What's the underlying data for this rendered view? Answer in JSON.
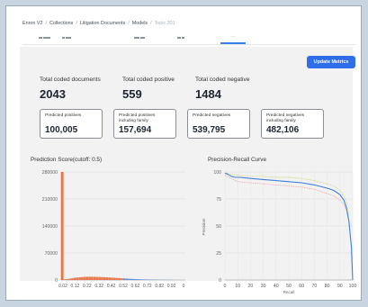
{
  "breadcrumb": [
    "Enron V2",
    "Collections",
    "Litigation Documents",
    "Models",
    "Topic 301"
  ],
  "tabs": [
    "",
    "",
    "",
    "",
    "..."
  ],
  "update_button": "Update Metrics",
  "stats": [
    {
      "label": "Total coded documents",
      "value": "2043"
    },
    {
      "label": "Total coded positive",
      "value": "559"
    },
    {
      "label": "Total coded negative",
      "value": "1484"
    }
  ],
  "cards": [
    {
      "label": "Predicted positives",
      "value": "100,005"
    },
    {
      "label": "Predicted positives including family",
      "value": "157,694"
    },
    {
      "label": "Predicted negatives",
      "value": "539,795"
    },
    {
      "label": "Predicted negatives including family",
      "value": "482,106"
    }
  ],
  "chart_data": [
    {
      "type": "bar",
      "title": "Prediction Score(cutoff: 0.5)",
      "xlabel": "",
      "ylabel": "",
      "y_ticks": [
        "0",
        "70000",
        "140000",
        "210000",
        "280000"
      ],
      "x_ticks": [
        "0.02",
        "0.12",
        "0.22",
        "0.32",
        "0.42",
        "0.52",
        "0.62",
        "0.72",
        "0.82",
        "0.92",
        "0"
      ],
      "ylim": [
        0,
        280000
      ],
      "colors": {
        "below_cutoff": "#e8622c",
        "above_cutoff": "#3f7fd9"
      },
      "bins_x": [
        0.01,
        0.03,
        0.05,
        0.07,
        0.09,
        0.11,
        0.13,
        0.15,
        0.17,
        0.19,
        0.21,
        0.23,
        0.25,
        0.27,
        0.29,
        0.31,
        0.33,
        0.35,
        0.37,
        0.39,
        0.41,
        0.43,
        0.45,
        0.47,
        0.49,
        0.51,
        0.53,
        0.55,
        0.57,
        0.59,
        0.61,
        0.63,
        0.65,
        0.67,
        0.69,
        0.71,
        0.73,
        0.75,
        0.77,
        0.79,
        0.81,
        0.83,
        0.85,
        0.87,
        0.89,
        0.91,
        0.93,
        0.95,
        0.97,
        0.99
      ],
      "values": [
        280000,
        1500,
        2500,
        3500,
        4500,
        5500,
        6500,
        7000,
        7500,
        8000,
        8200,
        8400,
        8300,
        8200,
        8000,
        7800,
        7500,
        7200,
        6800,
        6400,
        6000,
        5600,
        5200,
        4800,
        4400,
        4000,
        3600,
        3200,
        2800,
        2500,
        2200,
        1900,
        1600,
        1400,
        1200,
        1000,
        900,
        800,
        700,
        600,
        500,
        400,
        350,
        300,
        250,
        200,
        150,
        120,
        100,
        80
      ]
    },
    {
      "type": "line",
      "title": "Precision-Recall Curve",
      "xlabel": "Recall",
      "ylabel": "Precision",
      "xlim": [
        0,
        100
      ],
      "ylim": [
        0,
        100
      ],
      "x_ticks": [
        "0",
        "10",
        "20",
        "30",
        "40",
        "50",
        "60",
        "70",
        "80",
        "90",
        "100"
      ],
      "y_ticks": [
        "0",
        "25",
        "50",
        "75",
        "100"
      ],
      "series": [
        {
          "color": "#3f7fd9",
          "x": [
            0,
            2,
            5,
            8,
            12,
            20,
            30,
            40,
            50,
            60,
            70,
            80,
            85,
            90,
            93,
            95,
            97,
            99,
            100
          ],
          "y": [
            99,
            98,
            96,
            95,
            95,
            94,
            93,
            92,
            91,
            90,
            88,
            85,
            83,
            79,
            74,
            67,
            55,
            30,
            0
          ]
        },
        {
          "color": "#c7d66a",
          "x": [
            0,
            5,
            10,
            20,
            30,
            40,
            50,
            60,
            70,
            80,
            85,
            90,
            93,
            95,
            97
          ],
          "y": [
            99,
            98,
            97,
            96,
            96,
            95,
            95,
            94,
            92,
            89,
            87,
            83,
            78,
            72,
            60
          ]
        },
        {
          "color": "#e8a0a0",
          "x": [
            0,
            5,
            10,
            20,
            30,
            40,
            50,
            60,
            70,
            80,
            85,
            90,
            93,
            95
          ],
          "y": [
            97,
            94,
            91,
            90,
            89,
            88,
            87,
            86,
            84,
            80,
            78,
            74,
            70,
            65
          ]
        }
      ]
    }
  ]
}
